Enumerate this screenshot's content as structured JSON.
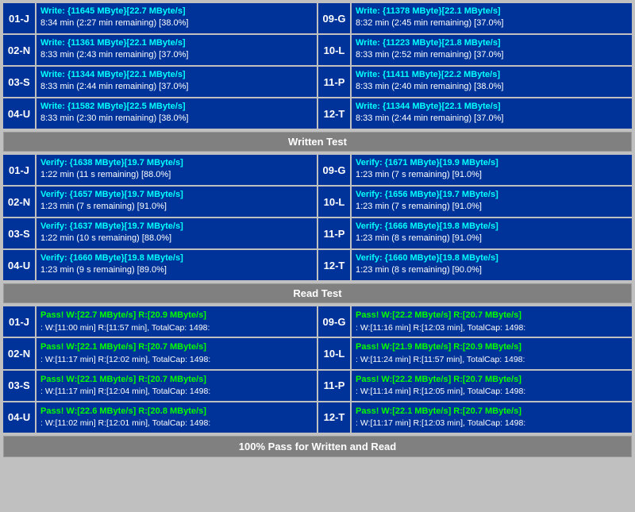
{
  "sections": {
    "write_test": {
      "label": "Written Test",
      "rows": [
        {
          "left_id": "01-J",
          "left_line1": "Write: {11645 MByte}[22.7 MByte/s]",
          "left_line2": "8:34 min (2:27 min remaining)  [38.0%]",
          "right_id": "09-G",
          "right_line1": "Write: {11378 MByte}[22.1 MByte/s]",
          "right_line2": "8:32 min (2:45 min remaining)  [37.0%]"
        },
        {
          "left_id": "02-N",
          "left_line1": "Write: {11361 MByte}[22.1 MByte/s]",
          "left_line2": "8:33 min (2:43 min remaining)  [37.0%]",
          "right_id": "10-L",
          "right_line1": "Write: {11223 MByte}[21.8 MByte/s]",
          "right_line2": "8:33 min (2:52 min remaining)  [37.0%]"
        },
        {
          "left_id": "03-S",
          "left_line1": "Write: {11344 MByte}[22.1 MByte/s]",
          "left_line2": "8:33 min (2:44 min remaining)  [37.0%]",
          "right_id": "11-P",
          "right_line1": "Write: {11411 MByte}[22.2 MByte/s]",
          "right_line2": "8:33 min (2:40 min remaining)  [38.0%]"
        },
        {
          "left_id": "04-U",
          "left_line1": "Write: {11582 MByte}[22.5 MByte/s]",
          "left_line2": "8:33 min (2:30 min remaining)  [38.0%]",
          "right_id": "12-T",
          "right_line1": "Write: {11344 MByte}[22.1 MByte/s]",
          "right_line2": "8:33 min (2:44 min remaining)  [37.0%]"
        }
      ]
    },
    "verify_test": {
      "rows": [
        {
          "left_id": "01-J",
          "left_line1": "Verify: {1638 MByte}[19.7 MByte/s]",
          "left_line2": "1:22 min (11 s remaining)  [88.0%]",
          "right_id": "09-G",
          "right_line1": "Verify: {1671 MByte}[19.9 MByte/s]",
          "right_line2": "1:23 min (7 s remaining)  [91.0%]"
        },
        {
          "left_id": "02-N",
          "left_line1": "Verify: {1657 MByte}[19.7 MByte/s]",
          "left_line2": "1:23 min (7 s remaining)  [91.0%]",
          "right_id": "10-L",
          "right_line1": "Verify: {1656 MByte}[19.7 MByte/s]",
          "right_line2": "1:23 min (7 s remaining)  [91.0%]"
        },
        {
          "left_id": "03-S",
          "left_line1": "Verify: {1637 MByte}[19.7 MByte/s]",
          "left_line2": "1:22 min (10 s remaining)  [88.0%]",
          "right_id": "11-P",
          "right_line1": "Verify: {1666 MByte}[19.8 MByte/s]",
          "right_line2": "1:23 min (8 s remaining)  [91.0%]"
        },
        {
          "left_id": "04-U",
          "left_line1": "Verify: {1660 MByte}[19.8 MByte/s]",
          "left_line2": "1:23 min (9 s remaining)  [89.0%]",
          "right_id": "12-T",
          "right_line1": "Verify: {1660 MByte}[19.8 MByte/s]",
          "right_line2": "1:23 min (8 s remaining)  [90.0%]"
        }
      ]
    },
    "read_test": {
      "label": "Read Test",
      "rows": [
        {
          "left_id": "01-J",
          "left_pass": "Pass! W:[22.7 MByte/s] R:[20.9 MByte/s]",
          "left_sub": ": W:[11:00 min] R:[11:57 min], TotalCap: 1498:",
          "right_id": "09-G",
          "right_pass": "Pass! W:[22.2 MByte/s] R:[20.7 MByte/s]",
          "right_sub": ": W:[11:16 min] R:[12:03 min], TotalCap: 1498:"
        },
        {
          "left_id": "02-N",
          "left_pass": "Pass! W:[22.1 MByte/s] R:[20.7 MByte/s]",
          "left_sub": ": W:[11:17 min] R:[12:02 min], TotalCap: 1498:",
          "right_id": "10-L",
          "right_pass": "Pass! W:[21.9 MByte/s] R:[20.9 MByte/s]",
          "right_sub": ": W:[11:24 min] R:[11:57 min], TotalCap: 1498:"
        },
        {
          "left_id": "03-S",
          "left_pass": "Pass! W:[22.1 MByte/s] R:[20.7 MByte/s]",
          "left_sub": ": W:[11:17 min] R:[12:04 min], TotalCap: 1498:",
          "right_id": "11-P",
          "right_pass": "Pass! W:[22.2 MByte/s] R:[20.7 MByte/s]",
          "right_sub": ": W:[11:14 min] R:[12:05 min], TotalCap: 1498:"
        },
        {
          "left_id": "04-U",
          "left_pass": "Pass! W:[22.6 MByte/s] R:[20.8 MByte/s]",
          "left_sub": ": W:[11:02 min] R:[12:01 min], TotalCap: 1498:",
          "right_id": "12-T",
          "right_pass": "Pass! W:[22.1 MByte/s] R:[20.7 MByte/s]",
          "right_sub": ": W:[11:17 min] R:[12:03 min], TotalCap: 1498:"
        }
      ]
    },
    "footer": "100% Pass for Written and Read"
  }
}
